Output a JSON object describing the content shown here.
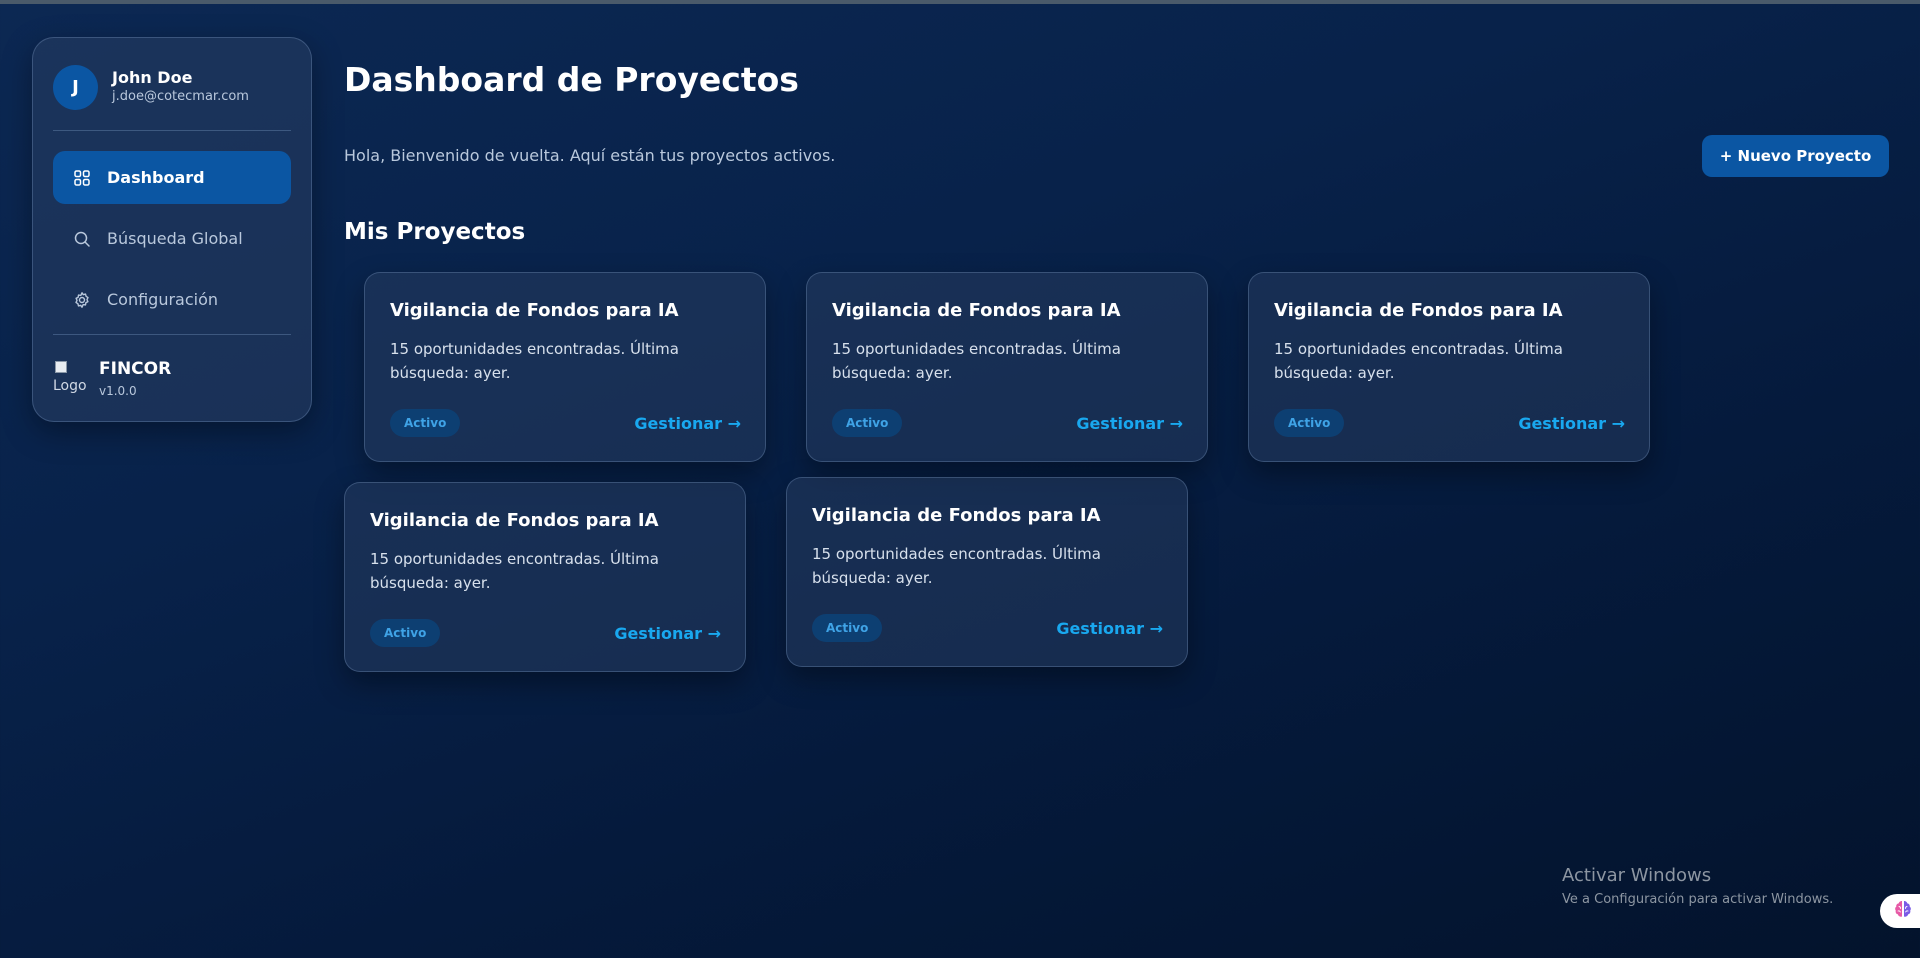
{
  "user": {
    "initial": "J",
    "name": "John Doe",
    "email": "j.doe@cotecmar.com"
  },
  "sidebar": {
    "items": [
      {
        "label": "Dashboard",
        "icon": "grid-icon",
        "active": true
      },
      {
        "label": "Búsqueda Global",
        "icon": "search-icon",
        "active": false
      },
      {
        "label": "Configuración",
        "icon": "gear-icon",
        "active": false
      }
    ],
    "brand": {
      "logo_alt": "Logo",
      "name": "FINCOR",
      "version": "v1.0.0"
    }
  },
  "main": {
    "title": "Dashboard de Proyectos",
    "subtitle": "Hola, Bienvenido de vuelta. Aquí están tus proyectos activos.",
    "new_project_label": "+ Nuevo Proyecto",
    "section_title": "Mis Proyectos",
    "projects": [
      {
        "title": "Vigilancia de Fondos para IA",
        "description": "15 oportunidades encontradas. Última búsqueda: ayer.",
        "status": "Activo",
        "action": "Gestionar →"
      },
      {
        "title": "Vigilancia de Fondos para IA",
        "description": "15 oportunidades encontradas. Última búsqueda: ayer.",
        "status": "Activo",
        "action": "Gestionar →"
      },
      {
        "title": "Vigilancia de Fondos para IA",
        "description": "15 oportunidades encontradas. Última búsqueda: ayer.",
        "status": "Activo",
        "action": "Gestionar →"
      },
      {
        "title": "Vigilancia de Fondos para IA",
        "description": "15 oportunidades encontradas. Última búsqueda: ayer.",
        "status": "Activo",
        "action": "Gestionar →"
      },
      {
        "title": "Vigilancia de Fondos para IA",
        "description": "15 oportunidades encontradas. Última búsqueda: ayer.",
        "status": "Activo",
        "action": "Gestionar →"
      }
    ]
  },
  "watermark": {
    "title": "Activar Windows",
    "subtitle": "Ve a Configuración para activar Windows."
  },
  "colors": {
    "accent": "#0b56a3",
    "link": "#19a8ef",
    "badge_bg": "#0d3f72",
    "badge_text": "#3fa3e6"
  }
}
